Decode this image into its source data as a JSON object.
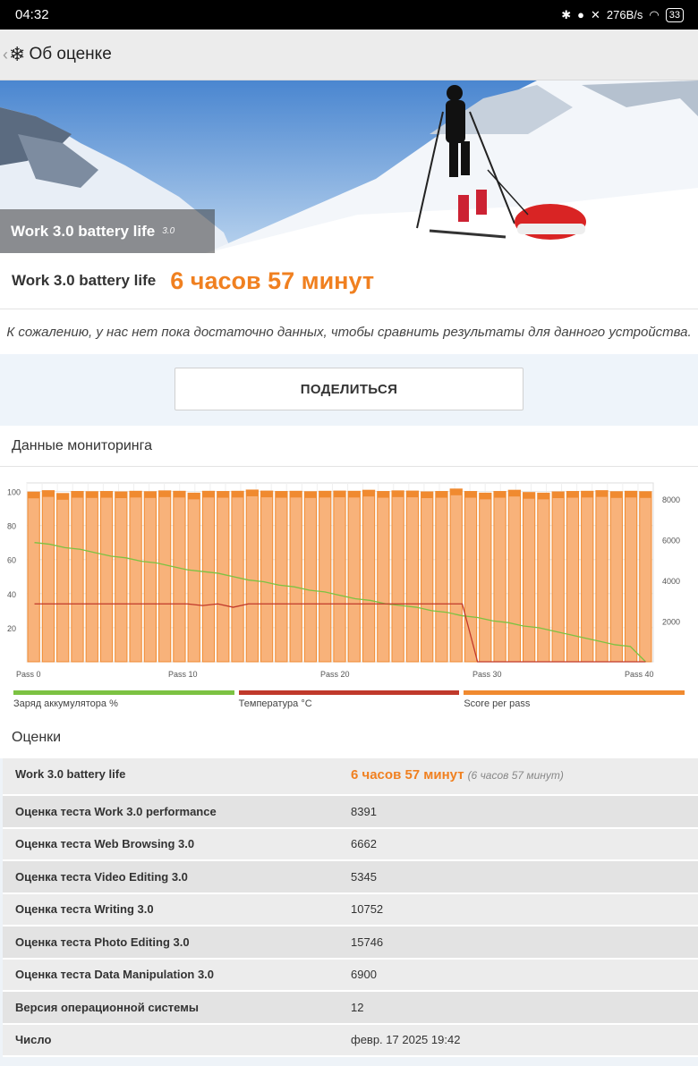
{
  "status_bar": {
    "time": "04:32",
    "net_speed": "276B/s",
    "battery": "33",
    "icons": [
      "bluetooth-icon",
      "location-icon",
      "mute-icon",
      "wifi-icon",
      "battery-icon"
    ]
  },
  "app_bar": {
    "title": "Об оценке",
    "back_icon": "chevron-left-icon",
    "logo_icon": "snowflake-icon"
  },
  "hero": {
    "label": "Work 3.0 battery life",
    "version": "3.0"
  },
  "result": {
    "name": "Work 3.0 battery life",
    "value": "6 часов 57 минут"
  },
  "note": "К сожалению, у нас нет пока достаточно данных, чтобы сравнить результаты для данного устройства.",
  "share_button": "ПОДЕЛИТЬСЯ",
  "monitoring": {
    "title": "Данные мониторинга",
    "legend": [
      {
        "label": "Заряд аккумулятора %",
        "color": "#7cc242"
      },
      {
        "label": "Температура °C",
        "color": "#c0392b"
      },
      {
        "label": "Score per pass",
        "color": "#f08a30"
      }
    ]
  },
  "chart_data": {
    "type": "bar",
    "x_tick_labels": [
      "Pass 0",
      "Pass 10",
      "Pass 20",
      "Pass 30",
      "Pass 40"
    ],
    "y_left_ticks": [
      "100",
      "80",
      "60",
      "40",
      "20"
    ],
    "y_right_ticks": [
      "8000",
      "6000",
      "4000",
      "2000"
    ],
    "ylim_left": [
      0,
      105
    ],
    "ylim_right": [
      0,
      8800
    ],
    "grid": true,
    "score_per_pass": [
      8350,
      8420,
      8280,
      8380,
      8370,
      8380,
      8360,
      8390,
      8370,
      8410,
      8390,
      8300,
      8390,
      8380,
      8390,
      8450,
      8400,
      8380,
      8390,
      8370,
      8390,
      8400,
      8390,
      8440,
      8380,
      8410,
      8400,
      8360,
      8380,
      8500,
      8380,
      8300,
      8380,
      8440,
      8330,
      8300,
      8360,
      8380,
      8390,
      8420,
      8370,
      8390,
      8370
    ],
    "battery_percent": [
      70,
      69,
      67,
      66,
      64,
      62,
      61,
      59,
      58,
      56,
      54,
      53,
      52,
      50,
      48,
      47,
      45,
      44,
      42,
      41,
      39,
      37,
      36,
      34,
      33,
      32,
      30,
      29,
      27,
      26,
      24,
      23,
      21,
      20,
      18,
      16,
      14,
      12,
      10,
      9,
      0
    ],
    "temperature_c": [
      34,
      34,
      34,
      34,
      34,
      34,
      34,
      34,
      34,
      34,
      34,
      33,
      34,
      32,
      34,
      34,
      34,
      34,
      34,
      34,
      34,
      34,
      34,
      34,
      34,
      34,
      34,
      34,
      34,
      0,
      0,
      0,
      0,
      0,
      0,
      0,
      0,
      0,
      0,
      0,
      0
    ]
  },
  "scores": {
    "title": "Оценки",
    "rows": [
      {
        "label": "Work 3.0 battery life",
        "value": "6 часов 57 минут",
        "sub": "(6 часов 57 минут)"
      },
      {
        "label": "Оценка теста Work 3.0 performance",
        "value": "8391"
      },
      {
        "label": "Оценка теста Web Browsing 3.0",
        "value": "6662"
      },
      {
        "label": "Оценка теста Video Editing 3.0",
        "value": "5345"
      },
      {
        "label": "Оценка теста Writing 3.0",
        "value": "10752"
      },
      {
        "label": "Оценка теста Photo Editing 3.0",
        "value": "15746"
      },
      {
        "label": "Оценка теста Data Manipulation 3.0",
        "value": "6900"
      },
      {
        "label": "Версия операционной системы",
        "value": "12"
      },
      {
        "label": "Число",
        "value": "февр. 17 2025 19:42"
      }
    ]
  }
}
